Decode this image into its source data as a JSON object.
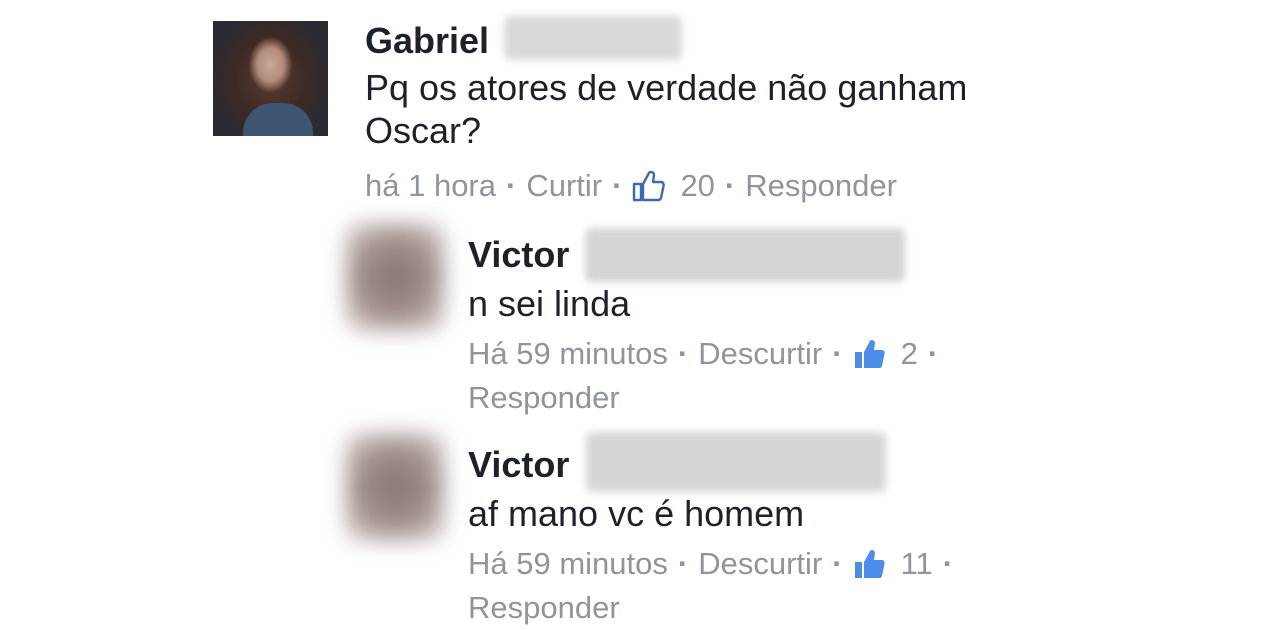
{
  "comments": [
    {
      "author": "Gabriel",
      "text_line1": "Pq os atores de verdade não ganham",
      "text_line2": "Oscar?",
      "time": "há 1 hora",
      "like_action": "Curtir",
      "like_count": "20",
      "reply_action": "Responder",
      "like_icon": "thumbs-up-icon",
      "like_icon_color": "#4267b2"
    },
    {
      "author": "Victor",
      "text": "n sei linda",
      "time": "Há 59 minutos",
      "like_action": "Descurtir",
      "like_count": "2",
      "reply_action": "Responder",
      "like_icon": "thumbs-up-icon",
      "like_icon_color": "#4b8de8"
    },
    {
      "author": "Victor",
      "text": "af mano vc é homem",
      "time": "Há 59 minutos",
      "like_action": "Descurtir",
      "like_count": "11",
      "reply_action": "Responder",
      "like_icon": "thumbs-up-icon",
      "like_icon_color": "#4b8de8"
    }
  ],
  "separator": "·",
  "colors": {
    "name": "#1d2129",
    "text": "#1d2129",
    "meta": "#90949c"
  }
}
